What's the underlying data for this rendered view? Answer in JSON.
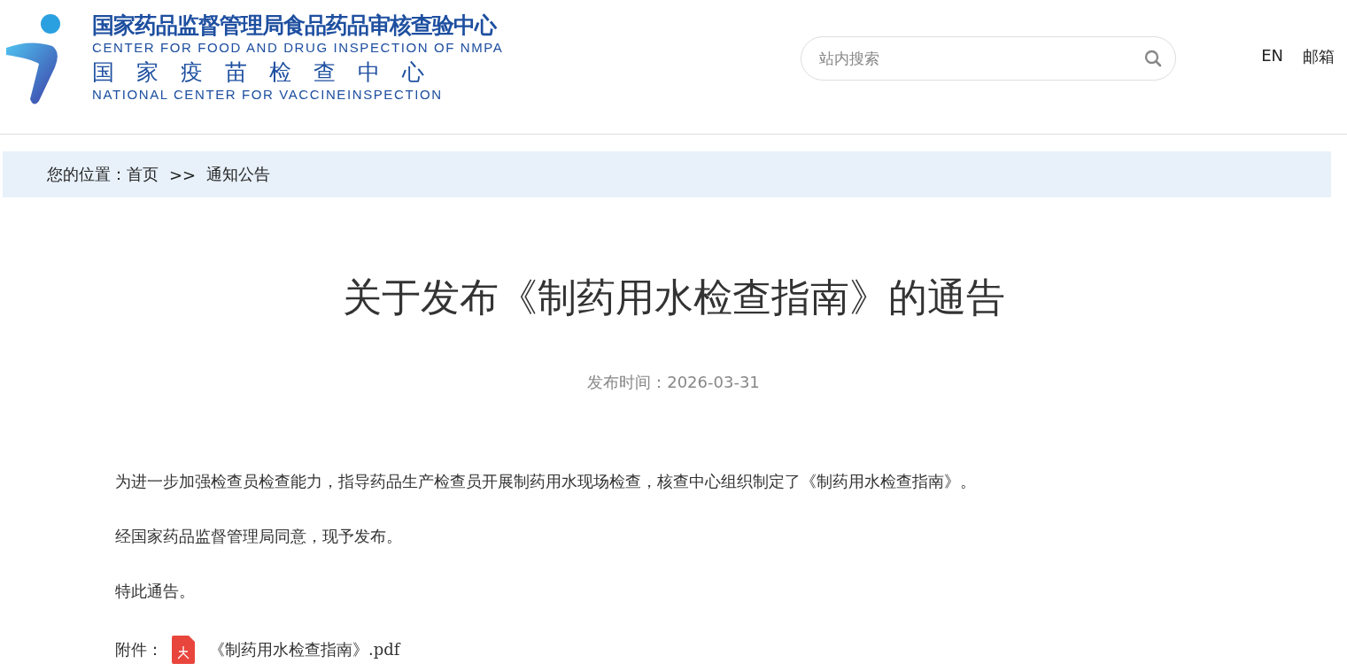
{
  "logo": {
    "title_cn": "国家药品监督管理局食品药品审核查验中心",
    "title_en": "CENTER FOR FOOD AND DRUG INSPECTION OF NMPA",
    "subtitle_cn": "国家疫苗检查中心",
    "subtitle_en": "NATIONAL CENTER FOR VACCINEINSPECTION"
  },
  "search": {
    "placeholder": "站内搜索"
  },
  "header_links": [
    "EN",
    "邮箱"
  ],
  "breadcrumb": {
    "label": "您的位置：",
    "items": [
      "首页",
      "通知公告"
    ],
    "separator": ">>"
  },
  "article": {
    "title": "关于发布《制药用水检查指南》的通告",
    "date": "发布时间：2026-03-31",
    "paragraphs": [
      "为进一步加强检查员检查能力，指导药品生产检查员开展制药用水现场检查，核查中心组织制定了《制药用水检查指南》。",
      "经国家药品监督管理局同意，现予发布。",
      "特此通告。"
    ],
    "attachment": {
      "label": "附件：",
      "file": "《制药用水检查指南》.pdf"
    }
  }
}
